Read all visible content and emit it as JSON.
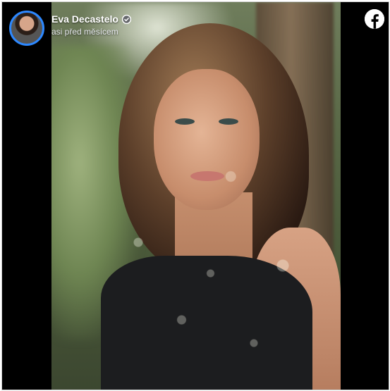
{
  "post": {
    "author_name": "Eva Decastelo",
    "timestamp": "asi před měsícem",
    "verified": true,
    "avatar_icon": "avatar",
    "brand_icon": "facebook-icon",
    "verified_icon": "verified-badge-icon",
    "photo_description_icon": "post-photo"
  },
  "colors": {
    "background": "#000000",
    "avatar_ring": "#2d88ff",
    "name_text": "#ffffff",
    "time_text": "#e4e6eb"
  }
}
